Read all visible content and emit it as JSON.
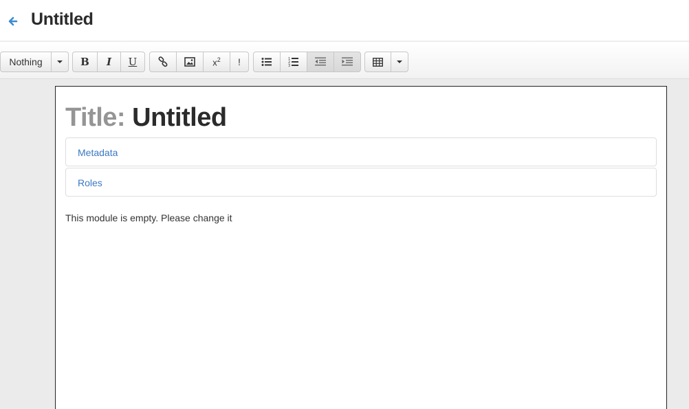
{
  "header": {
    "title": "Untitled",
    "back_icon": "arrow-left-icon"
  },
  "toolbar": {
    "style_select": {
      "value": "Nothing"
    },
    "format_buttons": [
      {
        "name": "bold",
        "glyph": "B"
      },
      {
        "name": "italic",
        "glyph": "I"
      },
      {
        "name": "underline",
        "glyph": "U"
      }
    ],
    "insert_buttons": [
      {
        "name": "link",
        "icon": "link-icon"
      },
      {
        "name": "image",
        "icon": "image-icon"
      },
      {
        "name": "superscript",
        "glyph": "x",
        "sup": "2"
      },
      {
        "name": "note",
        "glyph": "!"
      }
    ],
    "list_buttons": [
      {
        "name": "unordered-list",
        "icon": "list-ul-icon"
      },
      {
        "name": "ordered-list",
        "icon": "list-ol-icon"
      },
      {
        "name": "outdent",
        "icon": "outdent-icon"
      },
      {
        "name": "indent",
        "icon": "indent-icon"
      }
    ],
    "table_button": {
      "icon": "table-icon"
    }
  },
  "document": {
    "title_label": "Title:",
    "title_value": "Untitled",
    "panels": [
      {
        "label": "Metadata"
      },
      {
        "label": "Roles"
      }
    ],
    "empty_message": "This module is empty. Please change it"
  },
  "colors": {
    "accent_link": "#3a78c3",
    "back_arrow": "#3a8cd0",
    "title_label": "#959595",
    "text": "#2b2b2b"
  }
}
